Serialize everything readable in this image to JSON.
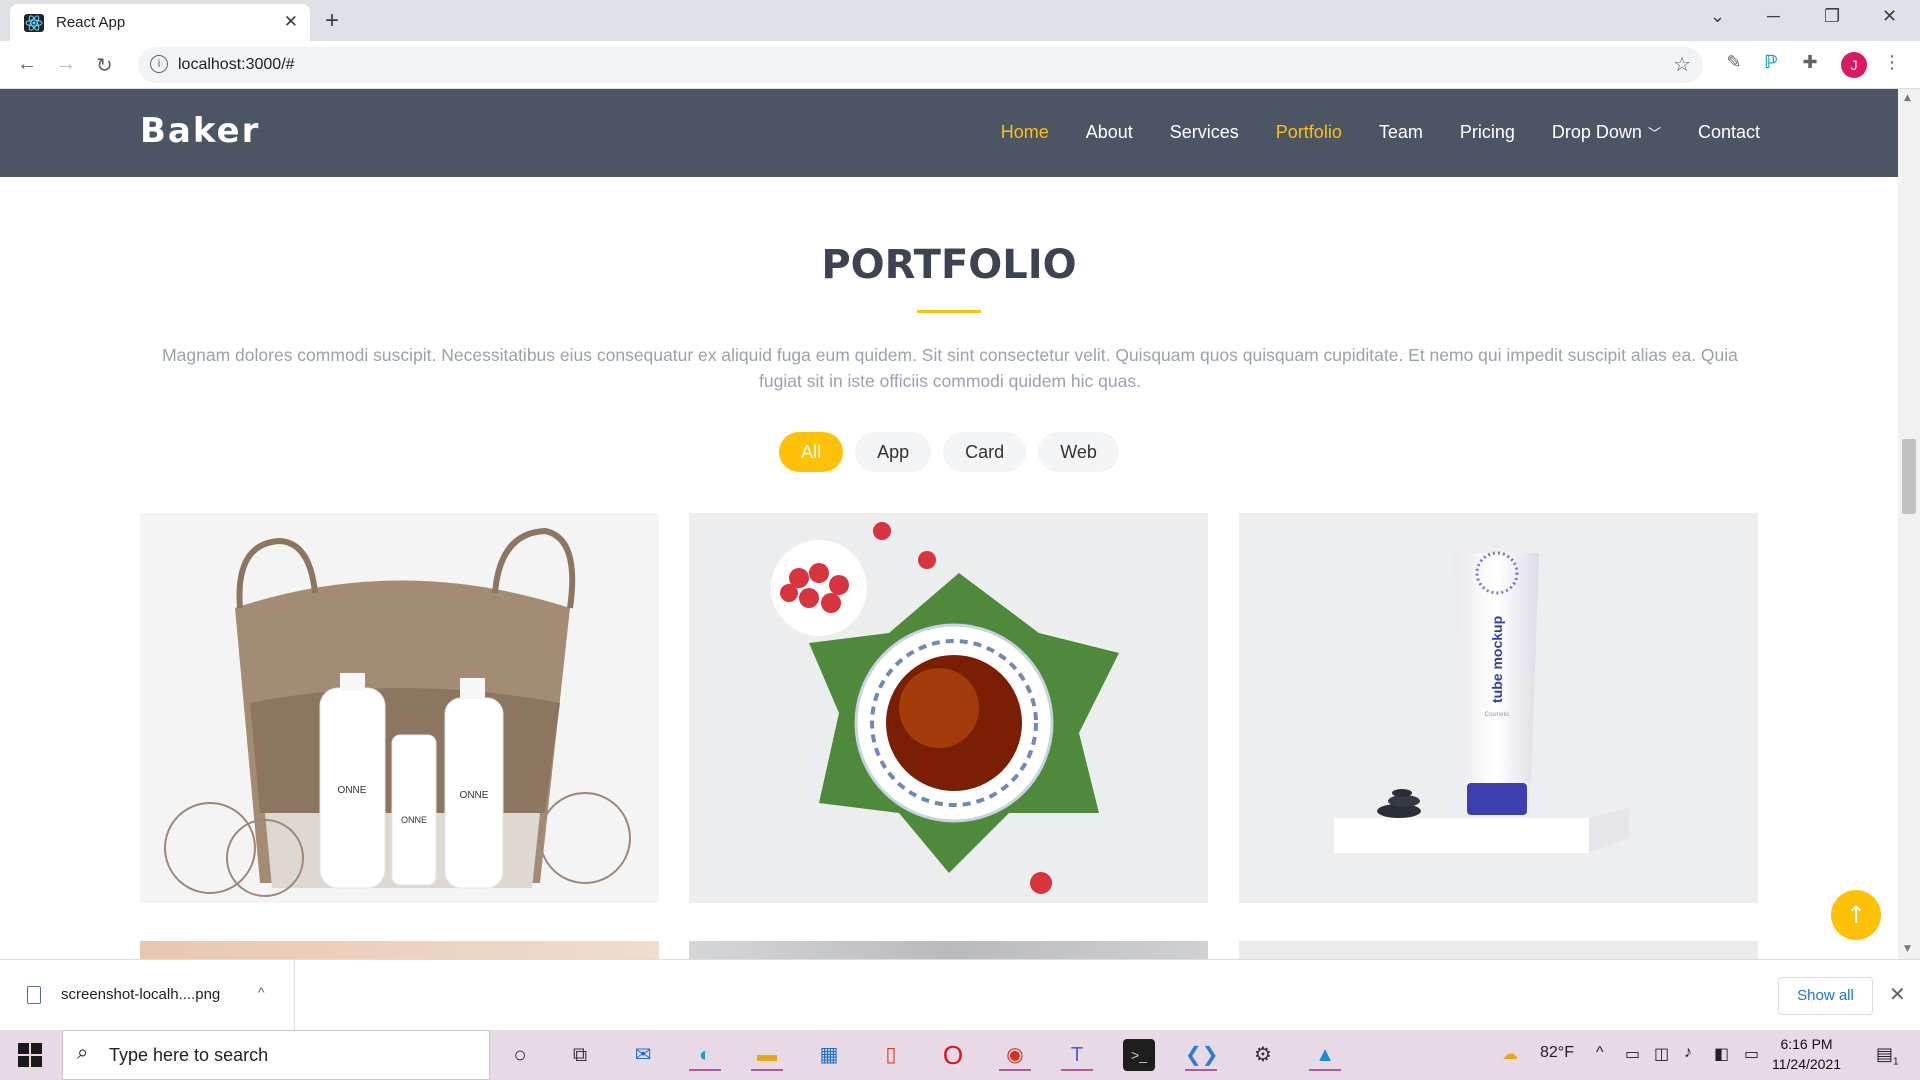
{
  "browser": {
    "tab_title": "React App",
    "url": "localhost:3000/#",
    "profile_initial": "J"
  },
  "site": {
    "logo": "Baker",
    "nav": [
      {
        "label": "Home",
        "active": true
      },
      {
        "label": "About",
        "active": false
      },
      {
        "label": "Services",
        "active": false
      },
      {
        "label": "Portfolio",
        "active": true
      },
      {
        "label": "Team",
        "active": false
      },
      {
        "label": "Pricing",
        "active": false
      },
      {
        "label": "Drop Down",
        "active": false
      },
      {
        "label": "Contact",
        "active": false
      }
    ],
    "accent_color": "#ffc107",
    "header_color": "#4b5563"
  },
  "portfolio": {
    "title": "PORTFOLIO",
    "description": "Magnam dolores commodi suscipit. Necessitatibus eius consequatur ex aliquid fuga eum quidem. Sit sint consectetur velit. Quisquam quos quisquam cupiditate. Et nemo qui impedit suscipit alias ea. Quia fugiat sit in iste officiis commodi quidem hic quas.",
    "filters": [
      {
        "label": "All",
        "active": true
      },
      {
        "label": "App",
        "active": false
      },
      {
        "label": "Card",
        "active": false
      },
      {
        "label": "Web",
        "active": false
      }
    ],
    "image_labels": {
      "brand": "ONNE",
      "tube_title": "tube mockup",
      "tube_sub": "Cosmetic"
    }
  },
  "downloads": {
    "file_name": "screenshot-localh....png",
    "show_all": "Show all"
  },
  "taskbar": {
    "search_placeholder": "Type here to search",
    "temperature": "82°F",
    "time": "6:16 PM",
    "date": "11/24/2021",
    "notification_count": "1"
  }
}
